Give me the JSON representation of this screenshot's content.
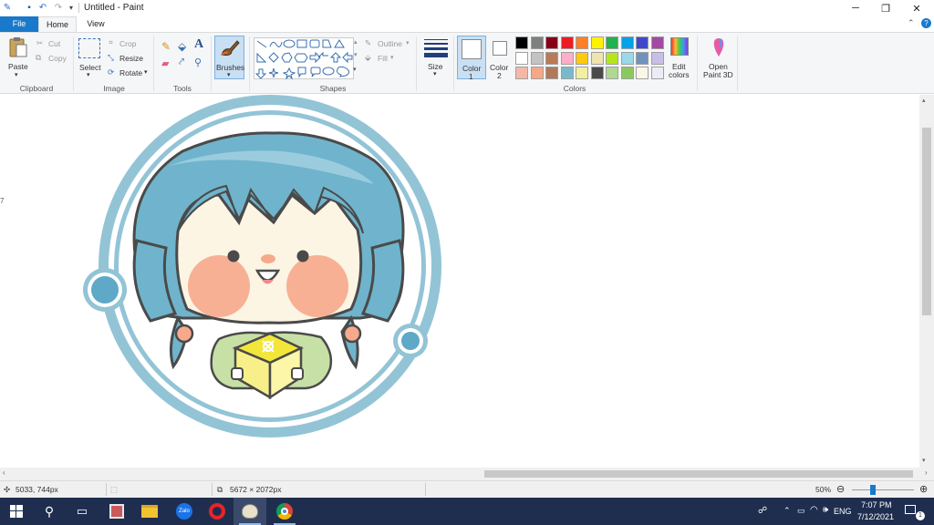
{
  "window": {
    "title": "Untitled - Paint",
    "controls": [
      "minimize",
      "restore",
      "close"
    ]
  },
  "tabs": [
    {
      "label": "File"
    },
    {
      "label": "Home"
    },
    {
      "label": "View"
    }
  ],
  "ribbon": {
    "clipboard": {
      "paste": "Paste",
      "cut": "Cut",
      "copy": "Copy",
      "group": "Clipboard"
    },
    "image": {
      "select": "Select",
      "crop": "Crop",
      "resize": "Resize",
      "rotate": "Rotate",
      "group": "Image"
    },
    "tools": {
      "group": "Tools"
    },
    "brushes": {
      "label": "Brushes"
    },
    "shapes": {
      "outline": "Outline",
      "fill": "Fill",
      "group": "Shapes"
    },
    "size": {
      "label": "Size"
    },
    "colors": {
      "color1": "Color",
      "color1_num": "1",
      "color2": "Color",
      "color2_num": "2",
      "edit_1": "Edit",
      "edit_2": "colors",
      "paint3d_1": "Open",
      "paint3d_2": "Paint 3D",
      "group": "Colors",
      "palette_row1": [
        "#000000",
        "#7f7f7f",
        "#880015",
        "#ed1c24",
        "#ff7f27",
        "#fff200",
        "#22b14c",
        "#00a2e8",
        "#3f48cc",
        "#a349a4"
      ],
      "palette_row2": [
        "#ffffff",
        "#c3c3c3",
        "#b97a57",
        "#ffaec9",
        "#ffc90e",
        "#efe4b0",
        "#b5e61d",
        "#99d9ea",
        "#7092be",
        "#c8bfe7"
      ],
      "palette_row3": [
        "#f4b8a8",
        "#f5a886",
        "#b07a5a",
        "#7ab8cc",
        "#f2f0a0",
        "#4a4a4a",
        "#b0d890",
        "#8cc860",
        "#fbf6e8",
        "#ecebf6"
      ]
    }
  },
  "canvas": {
    "ruler_mark": "7"
  },
  "status": {
    "cursor_pos": "5033, 744px",
    "image_size": "5672 × 2072px",
    "zoom": "50%",
    "zoom_level": 0.5
  },
  "taskbar": {
    "language": "ENG",
    "time": "7:07 PM",
    "date": "7/12/2021",
    "notification_count": "1"
  }
}
